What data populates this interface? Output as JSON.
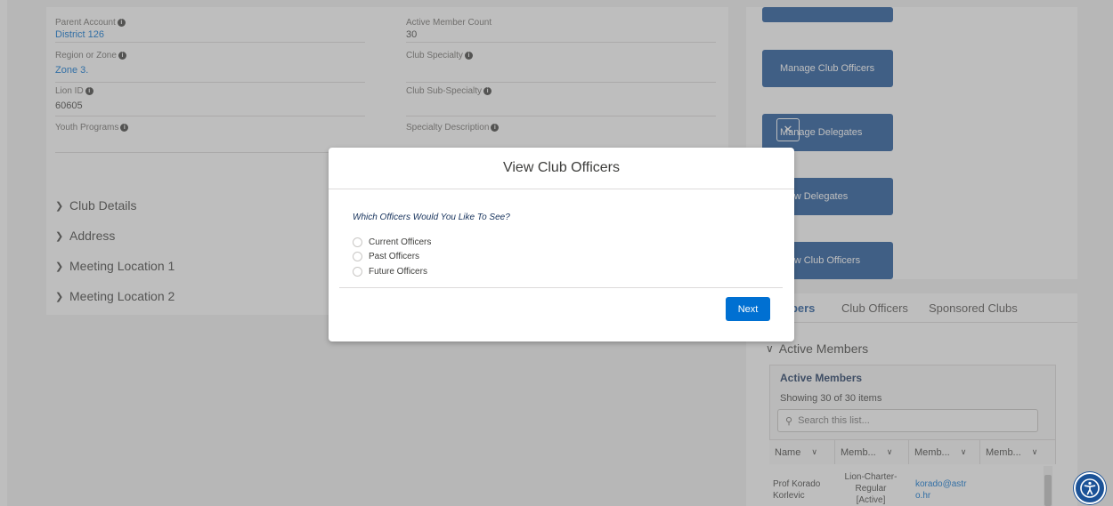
{
  "details": {
    "fields": [
      {
        "label": "Parent Account",
        "value": "District 126"
      },
      {
        "label": "Active Member Count",
        "value": "30"
      },
      {
        "label": "Region or Zone",
        "value": "Zone 3."
      },
      {
        "label": "Club Specialty",
        "value": ""
      },
      {
        "label": "Lion ID",
        "value": "60605"
      },
      {
        "label": "Club Sub-Specialty",
        "value": ""
      },
      {
        "label": "Youth Programs",
        "value": ""
      },
      {
        "label": "Specialty Description",
        "value": ""
      }
    ],
    "sections": [
      "Club Details",
      "Address",
      "Meeting Location 1",
      "Meeting Location 2"
    ]
  },
  "actions": {
    "manage_club_officers": "Manage Club Officers",
    "manage_delegates": "Manage Delegates",
    "view_delegates": "View Delegates",
    "view_club_officers": "View Club Officers"
  },
  "tabs": [
    {
      "label": "Members",
      "visible": "nbers",
      "active": true
    },
    {
      "label": "Club Officers",
      "active": false
    },
    {
      "label": "Sponsored Clubs",
      "active": false
    }
  ],
  "members": {
    "section_title": "Active Members",
    "list_title": "Active Members",
    "showing": "Showing 30 of 30 items",
    "search_placeholder": "Search this list...",
    "columns": [
      "Name",
      "Memb...",
      "Memb...",
      "Memb..."
    ],
    "rows": [
      {
        "name": "Prof Korado Korlevic",
        "membership": "Lion-Charter-Regular [Active]",
        "email": "korado@astro.hr"
      }
    ]
  },
  "modal": {
    "title": "View Club Officers",
    "question": "Which Officers Would You Like To See?",
    "options": [
      "Current Officers",
      "Past Officers",
      "Future Officers"
    ],
    "next_label": "Next"
  },
  "colors": {
    "brand": "#1b5297",
    "link": "#0070d2"
  }
}
